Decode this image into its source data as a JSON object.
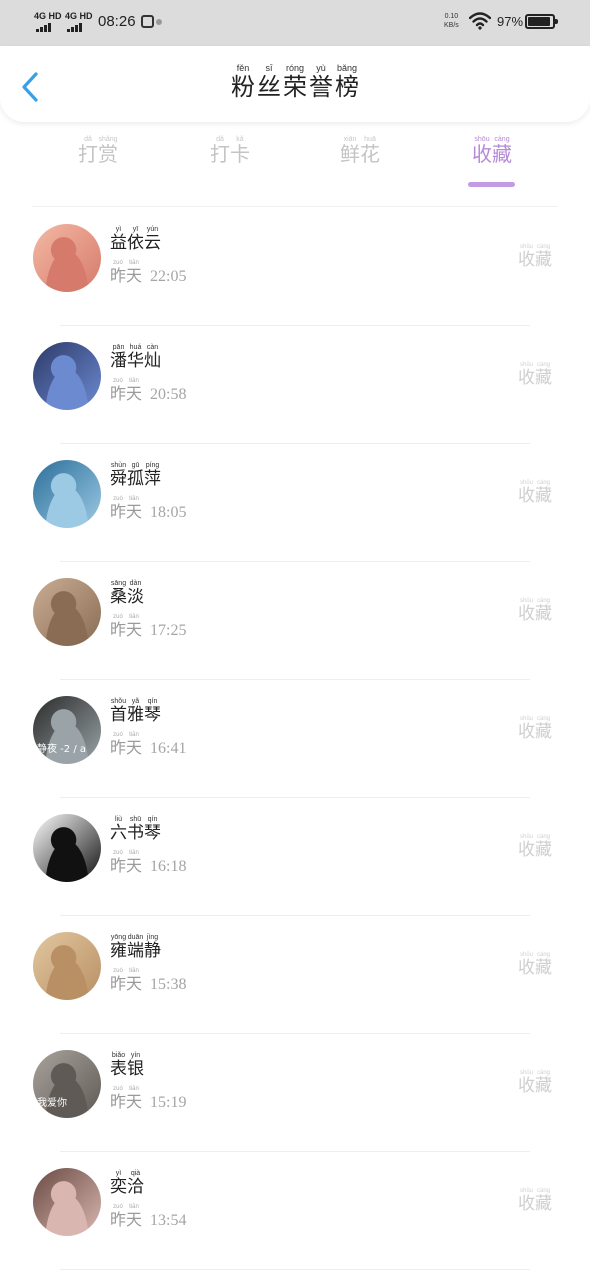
{
  "status_bar": {
    "network_1": "4G HD",
    "network_2": "4G HD",
    "time": "08:26",
    "net_speed_value": "0.10",
    "net_speed_unit": "KB/s",
    "battery": "97%"
  },
  "header": {
    "back_icon": "chevron-left-icon",
    "title_chars": [
      {
        "char": "粉",
        "pinyin": "fěn"
      },
      {
        "char": "丝",
        "pinyin": "sī"
      },
      {
        "char": "荣",
        "pinyin": "róng"
      },
      {
        "char": "誉",
        "pinyin": "yù"
      },
      {
        "char": "榜",
        "pinyin": "bǎng"
      }
    ]
  },
  "tabs": [
    {
      "name": "tab-dashang",
      "chars": [
        {
          "char": "打",
          "pinyin": "dǎ"
        },
        {
          "char": "赏",
          "pinyin": "shǎng"
        }
      ]
    },
    {
      "name": "tab-daka",
      "chars": [
        {
          "char": "打",
          "pinyin": "dǎ"
        },
        {
          "char": "卡",
          "pinyin": "kǎ"
        }
      ]
    },
    {
      "name": "tab-xianhua",
      "chars": [
        {
          "char": "鲜",
          "pinyin": "xiān"
        },
        {
          "char": "花",
          "pinyin": "huā"
        }
      ]
    },
    {
      "name": "tab-shoucang",
      "chars": [
        {
          "char": "收",
          "pinyin": "shōu"
        },
        {
          "char": "藏",
          "pinyin": "cáng"
        }
      ],
      "active": true
    }
  ],
  "colors": {
    "accent": "#c39be3",
    "status_bar_bg": "#dcdcdc",
    "back_arrow": "#3aa0e6"
  },
  "day_label": [
    {
      "char": "昨",
      "pinyin": "zuó"
    },
    {
      "char": "天",
      "pinyin": "tiān"
    }
  ],
  "action_label": [
    {
      "char": "收",
      "pinyin": "shōu"
    },
    {
      "char": "藏",
      "pinyin": "cáng"
    }
  ],
  "entries": [
    {
      "name": [
        {
          "char": "益",
          "pinyin": "yì"
        },
        {
          "char": "依",
          "pinyin": "yī"
        },
        {
          "char": "云",
          "pinyin": "yún"
        }
      ],
      "time": "22:05",
      "avatar_colors": [
        "#f3b9a3",
        "#d67a6b"
      ]
    },
    {
      "name": [
        {
          "char": "潘",
          "pinyin": "pān"
        },
        {
          "char": "华",
          "pinyin": "huá"
        },
        {
          "char": "灿",
          "pinyin": "càn"
        }
      ],
      "time": "20:58",
      "avatar_colors": [
        "#2d3a6a",
        "#6c8ad0"
      ]
    },
    {
      "name": [
        {
          "char": "舜",
          "pinyin": "shùn"
        },
        {
          "char": "孤",
          "pinyin": "gū"
        },
        {
          "char": "萍",
          "pinyin": "píng"
        }
      ],
      "time": "18:05",
      "avatar_colors": [
        "#2c6f9a",
        "#9cc9e4"
      ]
    },
    {
      "name": [
        {
          "char": "桑",
          "pinyin": "sāng"
        },
        {
          "char": "淡",
          "pinyin": "dàn"
        }
      ],
      "time": "17:25",
      "avatar_colors": [
        "#c9ad93",
        "#8a6c55"
      ]
    },
    {
      "name": [
        {
          "char": "首",
          "pinyin": "shǒu"
        },
        {
          "char": "雅",
          "pinyin": "yǎ"
        },
        {
          "char": "琴",
          "pinyin": "qín"
        }
      ],
      "time": "16:41",
      "avatar_colors": [
        "#2a2a2a",
        "#9aa4a8"
      ],
      "avatar_caption": "静夜 -2 / a"
    },
    {
      "name": [
        {
          "char": "六",
          "pinyin": "liù"
        },
        {
          "char": "书",
          "pinyin": "shū"
        },
        {
          "char": "琴",
          "pinyin": "qín"
        }
      ],
      "time": "16:18",
      "avatar_colors": [
        "#ffffff",
        "#111111"
      ]
    },
    {
      "name": [
        {
          "char": "雍",
          "pinyin": "yōng"
        },
        {
          "char": "端",
          "pinyin": "duān"
        },
        {
          "char": "静",
          "pinyin": "jìng"
        }
      ],
      "time": "15:38",
      "avatar_colors": [
        "#e2c7a0",
        "#b98f64"
      ]
    },
    {
      "name": [
        {
          "char": "表",
          "pinyin": "biǎo"
        },
        {
          "char": "银",
          "pinyin": "yín"
        }
      ],
      "time": "15:19",
      "avatar_colors": [
        "#a9a39c",
        "#5f5a55"
      ],
      "avatar_caption": "我爱你"
    },
    {
      "name": [
        {
          "char": "奕",
          "pinyin": "yì"
        },
        {
          "char": "洽",
          "pinyin": "qià"
        }
      ],
      "time": "13:54",
      "avatar_colors": [
        "#6a4a44",
        "#d9b7b0"
      ]
    }
  ]
}
